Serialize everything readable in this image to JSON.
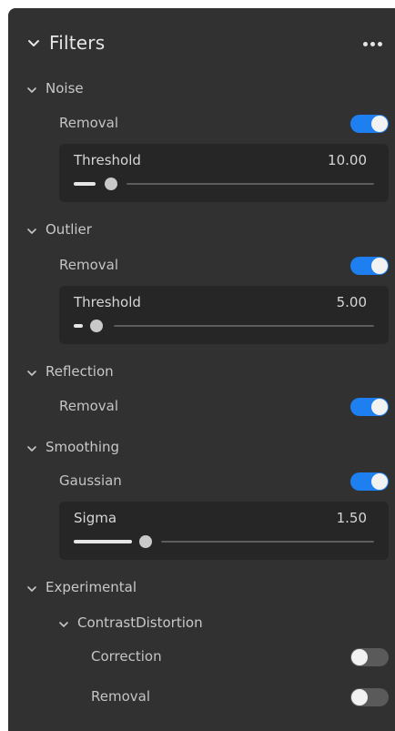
{
  "panel": {
    "title": "Filters",
    "more_icon": "more-horizontal-icon"
  },
  "sections": {
    "noise": {
      "label": "Noise",
      "removal": {
        "label": "Removal",
        "enabled": true
      },
      "threshold": {
        "label": "Threshold",
        "value": "10.00",
        "level": 0.2
      }
    },
    "outlier": {
      "label": "Outlier",
      "removal": {
        "label": "Removal",
        "enabled": true
      },
      "threshold": {
        "label": "Threshold",
        "value": "5.00",
        "level": 0.1
      }
    },
    "reflection": {
      "label": "Reflection",
      "removal": {
        "label": "Removal",
        "enabled": true
      }
    },
    "smoothing": {
      "label": "Smoothing",
      "gaussian": {
        "label": "Gaussian",
        "enabled": true
      },
      "sigma": {
        "label": "Sigma",
        "value": "1.50",
        "level": 0.3
      }
    },
    "experimental": {
      "label": "Experimental",
      "contrast_distortion": {
        "label": "ContrastDistortion",
        "correction": {
          "label": "Correction",
          "enabled": false
        },
        "removal": {
          "label": "Removal",
          "enabled": false
        }
      }
    }
  },
  "colors": {
    "panel_bg": "#313131",
    "param_bg": "#262626",
    "accent": "#1e7ff0",
    "toggle_off": "#5a5a5a"
  }
}
